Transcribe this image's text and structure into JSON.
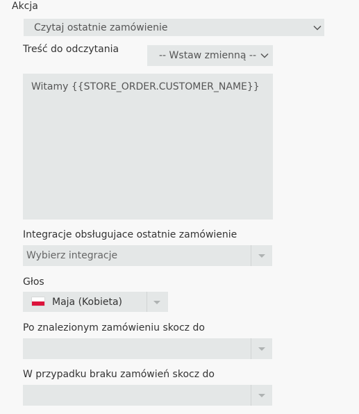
{
  "action": {
    "label": "Akcja",
    "value": "Czytaj ostatnie zamówienie"
  },
  "read_content": {
    "label": "Treść do odczytania",
    "insert_variable": "-- Wstaw zmienną --",
    "text": "Witamy {{STORE_ORDER.CUSTOMER_NAME}}"
  },
  "integrations": {
    "label": "Integracje obsługujace ostatnie zamówienie",
    "placeholder": "Wybierz integracje"
  },
  "voice": {
    "label": "Głos",
    "value": "Maja (Kobieta)",
    "flag": "flag-poland-icon",
    "flag_colors": {
      "top": "#ffffff",
      "bottom": "#dc143c"
    }
  },
  "found_goto": {
    "label": "Po znalezionym zamówieniu skocz do",
    "value": ""
  },
  "none_goto": {
    "label": "W przypadku braku zamówień skocz do",
    "value": ""
  },
  "colors": {
    "background": "#f8f8f8",
    "field": "#e4e7e7"
  }
}
